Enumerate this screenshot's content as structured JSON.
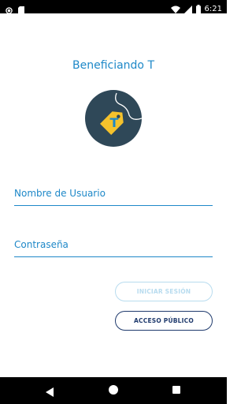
{
  "status_bar": {
    "time": "6:21",
    "icons": [
      "record-icon",
      "sim-card-icon",
      "wifi-icon",
      "signal-icon",
      "battery-icon"
    ]
  },
  "app": {
    "title": "Beneficiando T",
    "logo_letter": "T"
  },
  "login": {
    "username_placeholder": "Nombre de Usuario",
    "password_placeholder": "Contraseña",
    "login_button": "INICIAR SESIÓN",
    "public_access_button": "ACCESO PÚBLICO"
  },
  "colors": {
    "primary": "#1e88c8",
    "logo_background": "#2f4858",
    "logo_tag": "#f5c22c",
    "login_button_disabled": "#b8dcef",
    "public_button": "#1f3a6d"
  },
  "nav_bar": {
    "icons": [
      "back-icon",
      "home-icon",
      "recent-apps-icon"
    ]
  }
}
